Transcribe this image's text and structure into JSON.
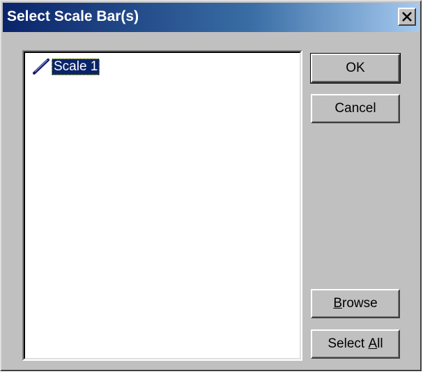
{
  "dialog": {
    "title": "Select Scale Bar(s)",
    "close_glyph": "×"
  },
  "list": {
    "items": [
      {
        "label": "Scale 1",
        "icon": "scale-bar-icon",
        "selected": true
      }
    ]
  },
  "buttons": {
    "ok": "OK",
    "cancel": "Cancel",
    "browse_first": "B",
    "browse_rest": "rowse",
    "select_all_prefix": "Select ",
    "select_all_u": "A",
    "select_all_rest": "ll"
  },
  "colors": {
    "titlebar_start": "#0a246a",
    "titlebar_end": "#a6caf0",
    "face": "#c0c0c0",
    "selection": "#0a246a"
  }
}
